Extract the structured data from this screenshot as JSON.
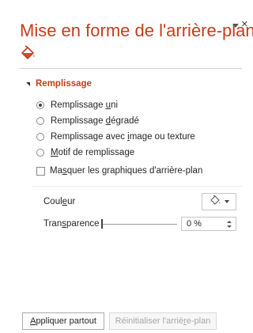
{
  "pane": {
    "title": "Mise en forme de l'arrière-plan",
    "close_glyph": "×",
    "tab_icon": "paint-bucket-icon"
  },
  "fill": {
    "section_title": "Remplissage",
    "options": [
      {
        "pre": "Remplissage ",
        "ul": "u",
        "post": "ni",
        "checked": true
      },
      {
        "pre": "Remplissage ",
        "ul": "d",
        "post": "égradé",
        "checked": false
      },
      {
        "pre": "Remplissage avec ",
        "ul": "i",
        "post": "mage ou texture",
        "checked": false
      },
      {
        "pre": "",
        "ul": "M",
        "post": "otif de remplissage",
        "checked": false
      }
    ],
    "hide_graphics": {
      "pre": "Ma",
      "ul": "s",
      "post": "quer les graphiques d'arrière-plan",
      "checked": false
    },
    "color": {
      "pre": "Coul",
      "ul": "e",
      "post": "ur",
      "icon": "paint-bucket-icon"
    },
    "transparency": {
      "pre": "Tran",
      "ul": "s",
      "post": "parence",
      "value": "0 %",
      "level": 0
    }
  },
  "buttons": {
    "apply": {
      "pre": "",
      "ul": "A",
      "post": "ppliquer partout"
    },
    "reset": {
      "pre": "Réinitialiser l'arriè",
      "ul": "r",
      "post": "e-plan"
    }
  }
}
